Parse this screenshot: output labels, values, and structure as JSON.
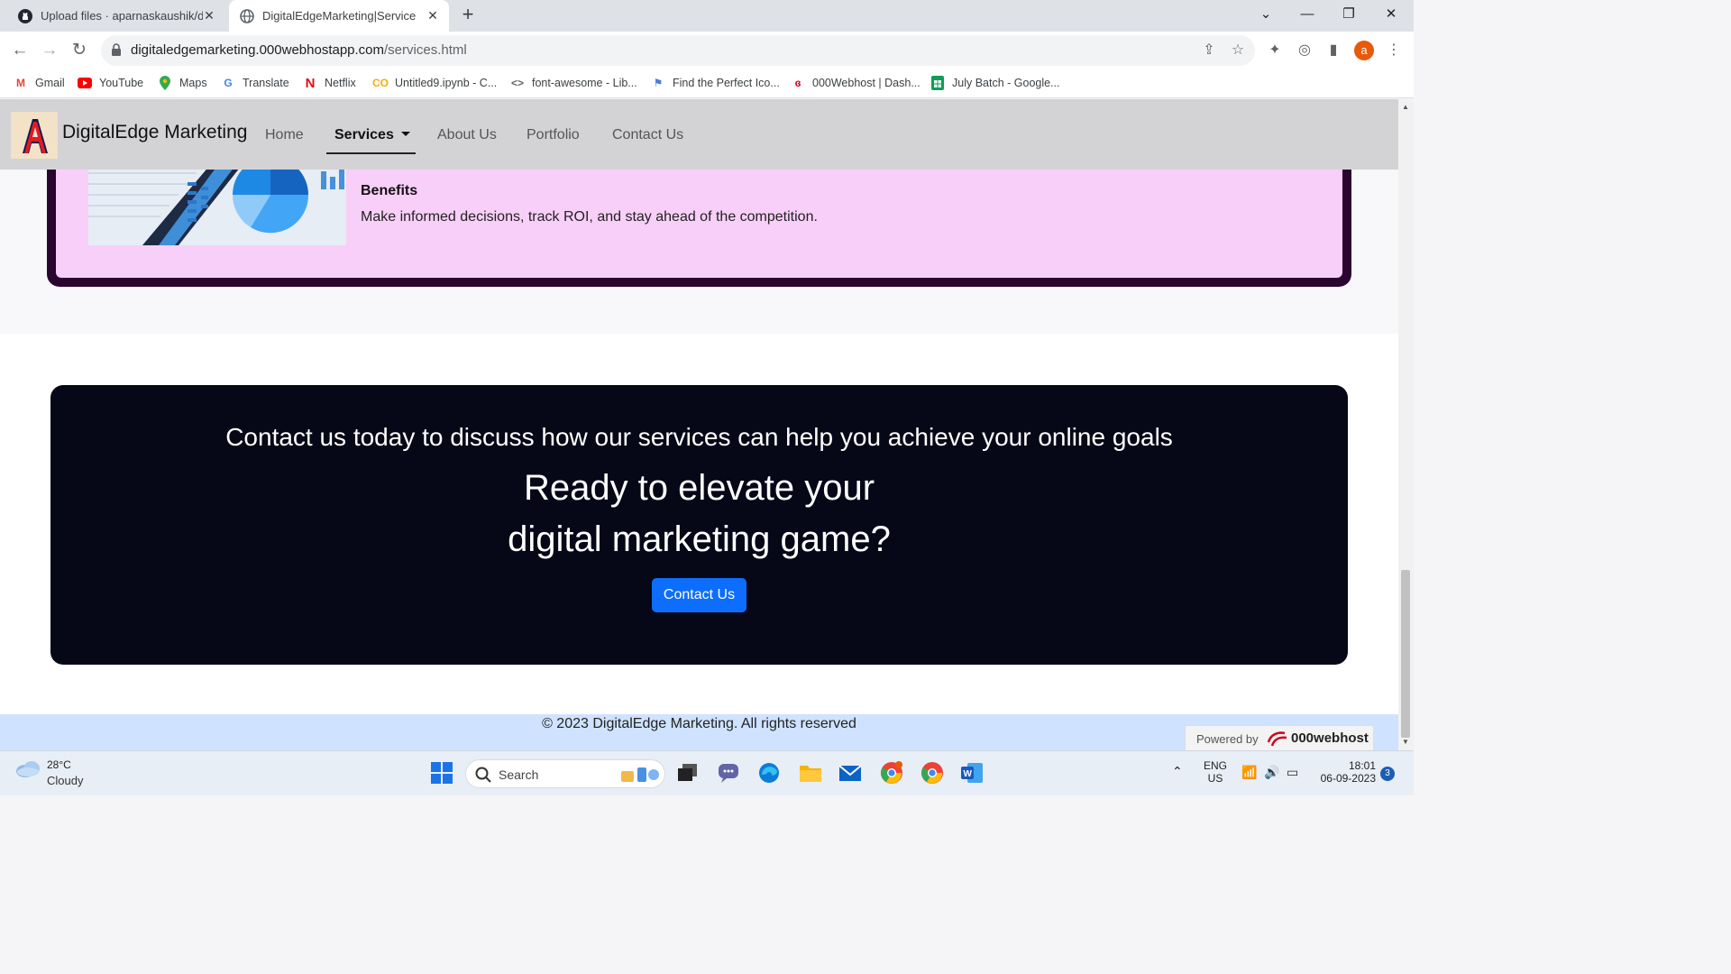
{
  "browser": {
    "tabs": [
      {
        "title": "Upload files · aparnaskaushik/dig",
        "icon": "github-icon"
      },
      {
        "title": "DigitalEdgeMarketing|Services|",
        "icon": "globe-icon",
        "active": true
      }
    ],
    "url_host": "digitaledgemarketing.000webhostapp.com",
    "url_path": "/services.html",
    "profile_initial": "a",
    "bookmarks": [
      {
        "label": "Gmail",
        "icon": "gmail-icon"
      },
      {
        "label": "YouTube",
        "icon": "youtube-icon"
      },
      {
        "label": "Maps",
        "icon": "maps-icon"
      },
      {
        "label": "Translate",
        "icon": "translate-icon"
      },
      {
        "label": "Netflix",
        "icon": "netflix-icon"
      },
      {
        "label": "Untitled9.ipynb - C...",
        "icon": "colab-icon"
      },
      {
        "label": "font-awesome - Lib...",
        "icon": "code-icon"
      },
      {
        "label": "Find the Perfect Ico...",
        "icon": "flag-icon"
      },
      {
        "label": "000Webhost | Dash...",
        "icon": "webhost-icon"
      },
      {
        "label": "July Batch - Google...",
        "icon": "sheets-icon"
      }
    ]
  },
  "site": {
    "brand": "DigitalEdge Marketing",
    "logo_letter": "A",
    "nav": [
      "Home",
      "Services",
      "About Us",
      "Portfolio",
      "Contact Us"
    ],
    "active_nav": "Services",
    "service": {
      "title": "Benefits",
      "description": "Make informed decisions, track ROI, and stay ahead of the competition."
    },
    "cta": {
      "subtitle": "Contact us today to discuss how our services can help you achieve your online goals",
      "heading_line1": "Ready to elevate your",
      "heading_line2": "digital marketing game?",
      "button": "Contact Us"
    },
    "footer": "© 2023 DigitalEdge Marketing. All rights reserved",
    "powered_label": "Powered by",
    "powered_brand": "000webhost"
  },
  "taskbar": {
    "temperature": "28°C",
    "condition": "Cloudy",
    "search_label": "Search",
    "lang": "ENG",
    "region": "US",
    "time": "18:01",
    "date": "06-09-2023",
    "notifications": "3"
  },
  "colors": {
    "cta_bg": "#060717",
    "button_blue": "#0d6efd",
    "card_pink": "#f8cff8",
    "card_border": "#2a0530",
    "footer_bg": "#cfe2ff"
  }
}
